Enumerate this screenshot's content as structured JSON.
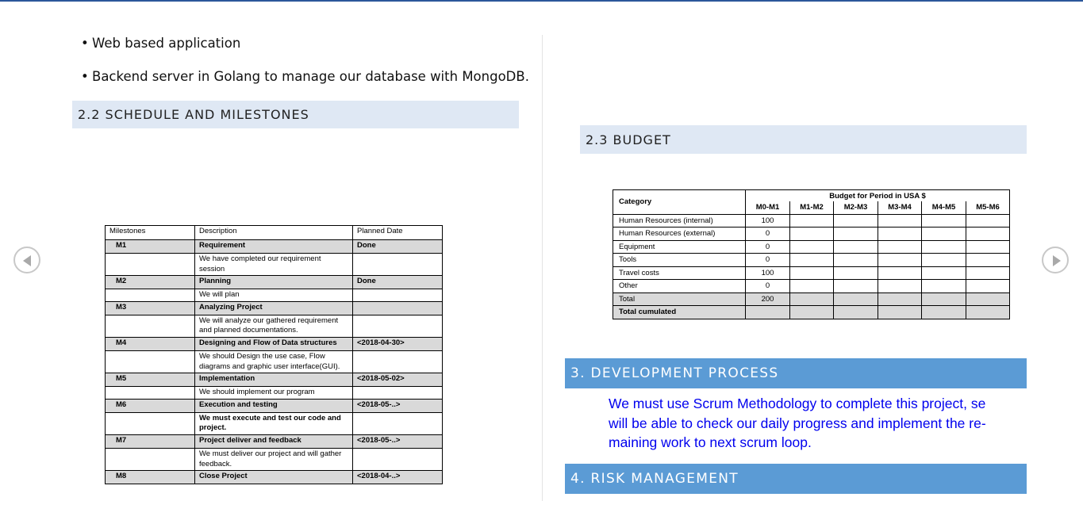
{
  "bullets": [
    "Web based application",
    "Backend server in Golang to manage our database with MongoDB."
  ],
  "bullet_glyph": "•",
  "sections": {
    "schedule": "2.2 SCHEDULE AND MILESTONES",
    "budget": "2.3 BUDGET",
    "development": "3. DEVELOPMENT PROCESS",
    "risk": "4. RISK MANAGEMENT"
  },
  "milestones": {
    "headers": [
      "Milestones",
      "Description",
      "Planned Date"
    ],
    "rows": [
      {
        "id": "M1",
        "title": "Requirement",
        "date": "Done",
        "desc": [
          "We have completed our requirement",
          "session"
        ]
      },
      {
        "id": "M2",
        "title": "Planning",
        "date": "Done",
        "desc": [
          "We will plan"
        ]
      },
      {
        "id": "M3",
        "title": "Analyzing Project",
        "date": "",
        "desc": [
          "We will analyze our gathered requirement",
          "and planned documentations."
        ]
      },
      {
        "id": "M4",
        "title": "Designing and Flow of Data structures",
        "date": "<2018-04-30>",
        "desc": [
          "We should Design the use case, Flow",
          "diagrams and graphic user interface(GUI)."
        ]
      },
      {
        "id": "M5",
        "title": "Implementation",
        "date": "<2018-05-02>",
        "desc": [
          "We should implement our program"
        ]
      },
      {
        "id": "M6",
        "title": "Execution and testing",
        "date": "<2018-05-..>",
        "desc": [
          "We must execute and test our code and",
          "project."
        ]
      },
      {
        "id": "M7",
        "title": "Project deliver and feedback",
        "date": "<2018-05-..>",
        "desc": [
          "We must deliver our project and will gather",
          "feedback."
        ]
      },
      {
        "id": "M8",
        "title": "Close Project",
        "date": "<2018-04-..>",
        "desc": []
      }
    ]
  },
  "budget": {
    "category_header": "Category",
    "period_header": "Budget for Period in USA $",
    "periods": [
      "M0-M1",
      "M1-M2",
      "M2-M3",
      "M3-M4",
      "M4-M5",
      "M5-M6"
    ],
    "rows": [
      {
        "category": "Human Resources (internal)",
        "value": "100"
      },
      {
        "category": "Human Resources (external)",
        "value": "0"
      },
      {
        "category": "Equipment",
        "value": "0"
      },
      {
        "category": "Tools",
        "value": "0"
      },
      {
        "category": "Travel costs",
        "value": "100"
      },
      {
        "category": "Other",
        "value": "0"
      },
      {
        "category": "Total",
        "value": "200"
      },
      {
        "category": "Total cumulated",
        "value": ""
      }
    ]
  },
  "development_paragraph": [
    "We must use Scrum Methodology to complete this project, se",
    "will be able to check our daily progress and implement the re-",
    "maining work to next scrum loop."
  ],
  "colors": {
    "heading2_bg": "#dfe8f4",
    "heading1_bg": "#5b9bd5",
    "paragraph_text": "#0000ee",
    "table_shade": "#d9d9d9"
  },
  "icons": {
    "prev": "chevron-left-icon",
    "next": "chevron-right-icon"
  }
}
